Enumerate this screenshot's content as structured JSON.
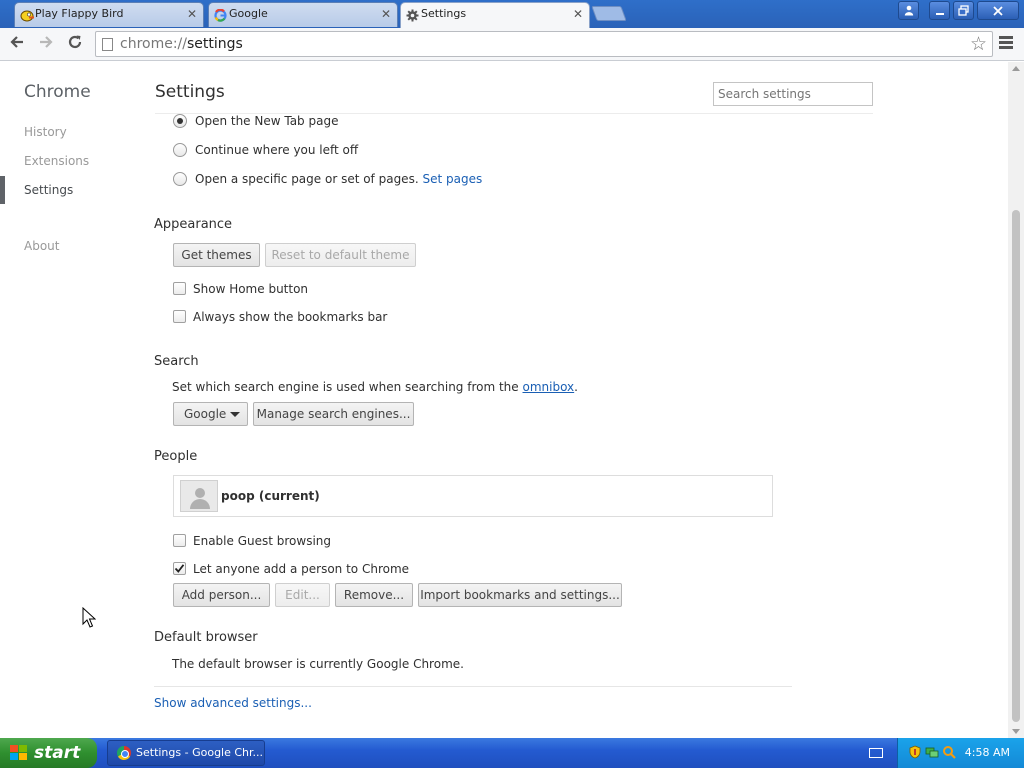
{
  "browser": {
    "tabs": [
      {
        "title": "Play Flappy Bird",
        "active": false
      },
      {
        "title": "Google",
        "active": false
      },
      {
        "title": "Settings",
        "active": true
      }
    ],
    "tab_close": "✕",
    "omnibox": {
      "scheme": "chrome://",
      "host": "settings"
    }
  },
  "sidebar": {
    "brand": "Chrome",
    "items": [
      {
        "label": "History"
      },
      {
        "label": "Extensions"
      },
      {
        "label": "Settings",
        "selected": true
      },
      {
        "label": "About"
      }
    ]
  },
  "settings": {
    "title": "Settings",
    "search_placeholder": "Search settings",
    "startup": {
      "options": [
        {
          "label": "Open the New Tab page",
          "checked": true
        },
        {
          "label": "Continue where you left off",
          "checked": false
        },
        {
          "label": "Open a specific page or set of pages.",
          "checked": false
        }
      ],
      "set_pages_link": "Set pages"
    },
    "appearance": {
      "heading": "Appearance",
      "get_themes": "Get themes",
      "reset_theme": "Reset to default theme",
      "show_home": "Show Home button",
      "show_bookmarks": "Always show the bookmarks bar"
    },
    "search": {
      "heading": "Search",
      "description": "Set which search engine is used when searching from the",
      "omnibox_link": "omnibox",
      "period": ".",
      "engine": "Google",
      "manage": "Manage search engines..."
    },
    "people": {
      "heading": "People",
      "profile_name": "poop (current)",
      "guest": "Enable Guest browsing",
      "guest_checked": false,
      "let_anyone": "Let anyone add a person to Chrome",
      "let_anyone_checked": true,
      "add_person": "Add person...",
      "edit": "Edit...",
      "remove": "Remove...",
      "import": "Import bookmarks and settings..."
    },
    "default_browser": {
      "heading": "Default browser",
      "status": "The default browser is currently Google Chrome."
    },
    "advanced_link": "Show advanced settings..."
  },
  "taskbar": {
    "start": "start",
    "task": "Settings - Google Chr...",
    "clock": "4:58 AM"
  }
}
